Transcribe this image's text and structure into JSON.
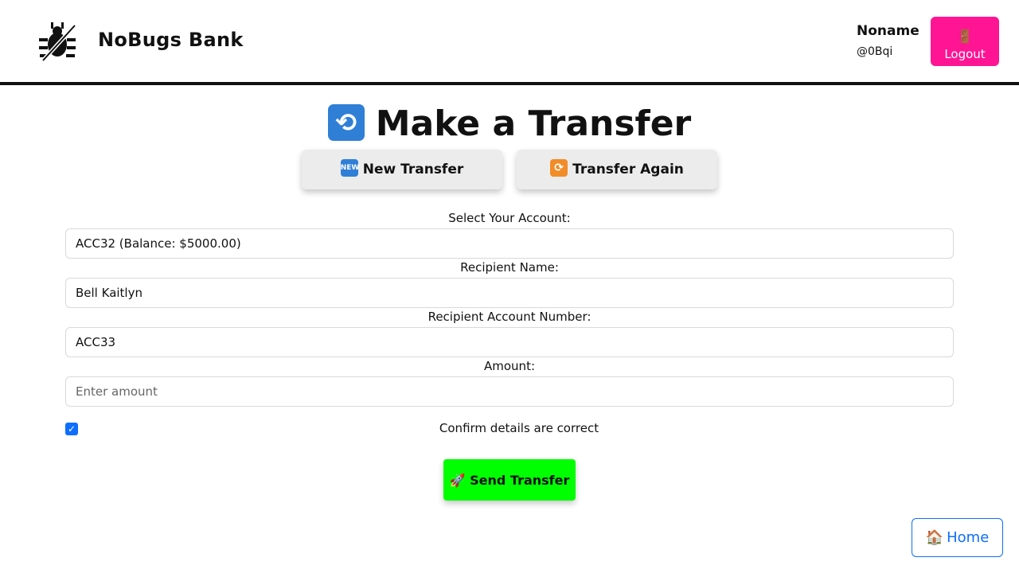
{
  "header": {
    "brand": "NoBugs Bank",
    "user_name": "Noname",
    "user_handle": "@0Bqi",
    "logout_label": "Logout",
    "logout_icon": "🚪"
  },
  "main": {
    "title": "Make a Transfer",
    "title_icon": "🔄",
    "tabs": [
      {
        "label": "New Transfer",
        "icon": "NEW"
      },
      {
        "label": "Transfer Again",
        "icon": "🔁"
      }
    ],
    "form": {
      "account_label": "Select Your Account:",
      "account_value": "ACC32 (Balance: $5000.00)",
      "recipient_name_label": "Recipient Name:",
      "recipient_name_value": "Bell Kaitlyn",
      "recipient_account_label": "Recipient Account Number:",
      "recipient_account_value": "ACC33",
      "amount_label": "Amount:",
      "amount_placeholder": "Enter amount",
      "confirm_label": "Confirm details are correct",
      "confirm_checked": true
    },
    "send_label": "🚀 Send Transfer"
  },
  "footer": {
    "home_label": "Home",
    "home_icon": "🏠"
  },
  "colors": {
    "logout_bg": "#ff1493",
    "send_bg": "#00ff00",
    "home_accent": "#0d6efd",
    "checkbox": "#0d6efd"
  }
}
